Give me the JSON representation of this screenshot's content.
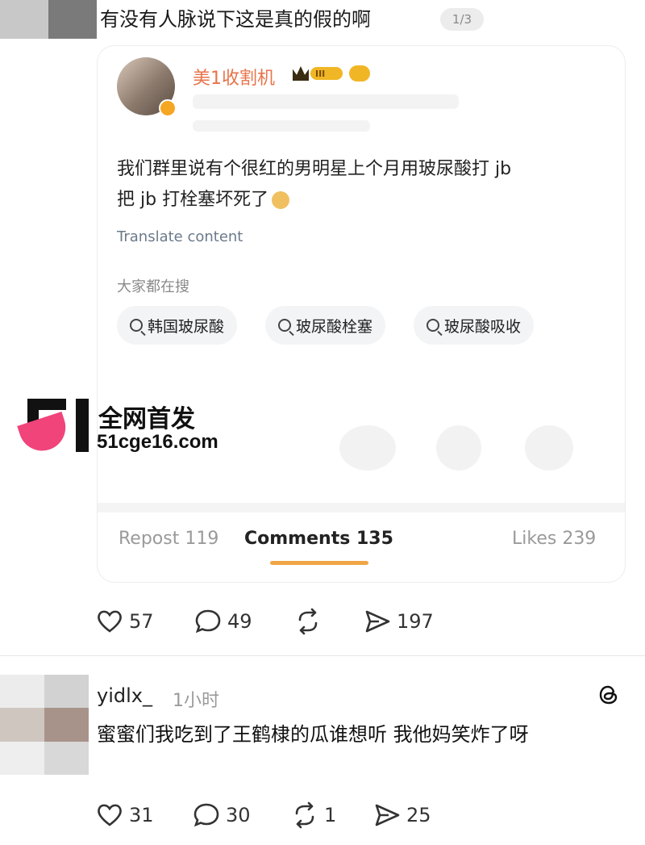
{
  "post": {
    "text": "有没有人脉说下这是真的假的啊",
    "page_indicator": "1/3"
  },
  "card": {
    "author_name": "美1收割机",
    "level_badge": "III",
    "body_line1": "我们群里说有个很红的男明星上个月用玻尿酸打 jb",
    "body_line2": "把 jb 打栓塞坏死了",
    "translate_label": "Translate content",
    "search_label": "大家都在搜",
    "chips": [
      "韩国玻尿酸",
      "玻尿酸栓塞",
      "玻尿酸吸收"
    ],
    "tabs": {
      "repost": "Repost 119",
      "comments": "Comments 135",
      "likes": "Likes 239"
    }
  },
  "watermark": {
    "title": "全网首发",
    "url": "51cge16.com"
  },
  "post_actions": {
    "likes": "57",
    "comments": "49",
    "shares": "197"
  },
  "comment": {
    "username": "yidlx_",
    "time": "1小时",
    "text": "蜜蜜们我吃到了王鹤棣的瓜谁想听 我他妈笑炸了呀",
    "likes": "31",
    "replies": "30",
    "reposts": "1",
    "shares": "25"
  },
  "colors": {
    "author_name": "#e8734a",
    "tab_underline": "#f0a646",
    "watermark_pink": "#f0447a",
    "translate_link": "#6b7a8a"
  }
}
